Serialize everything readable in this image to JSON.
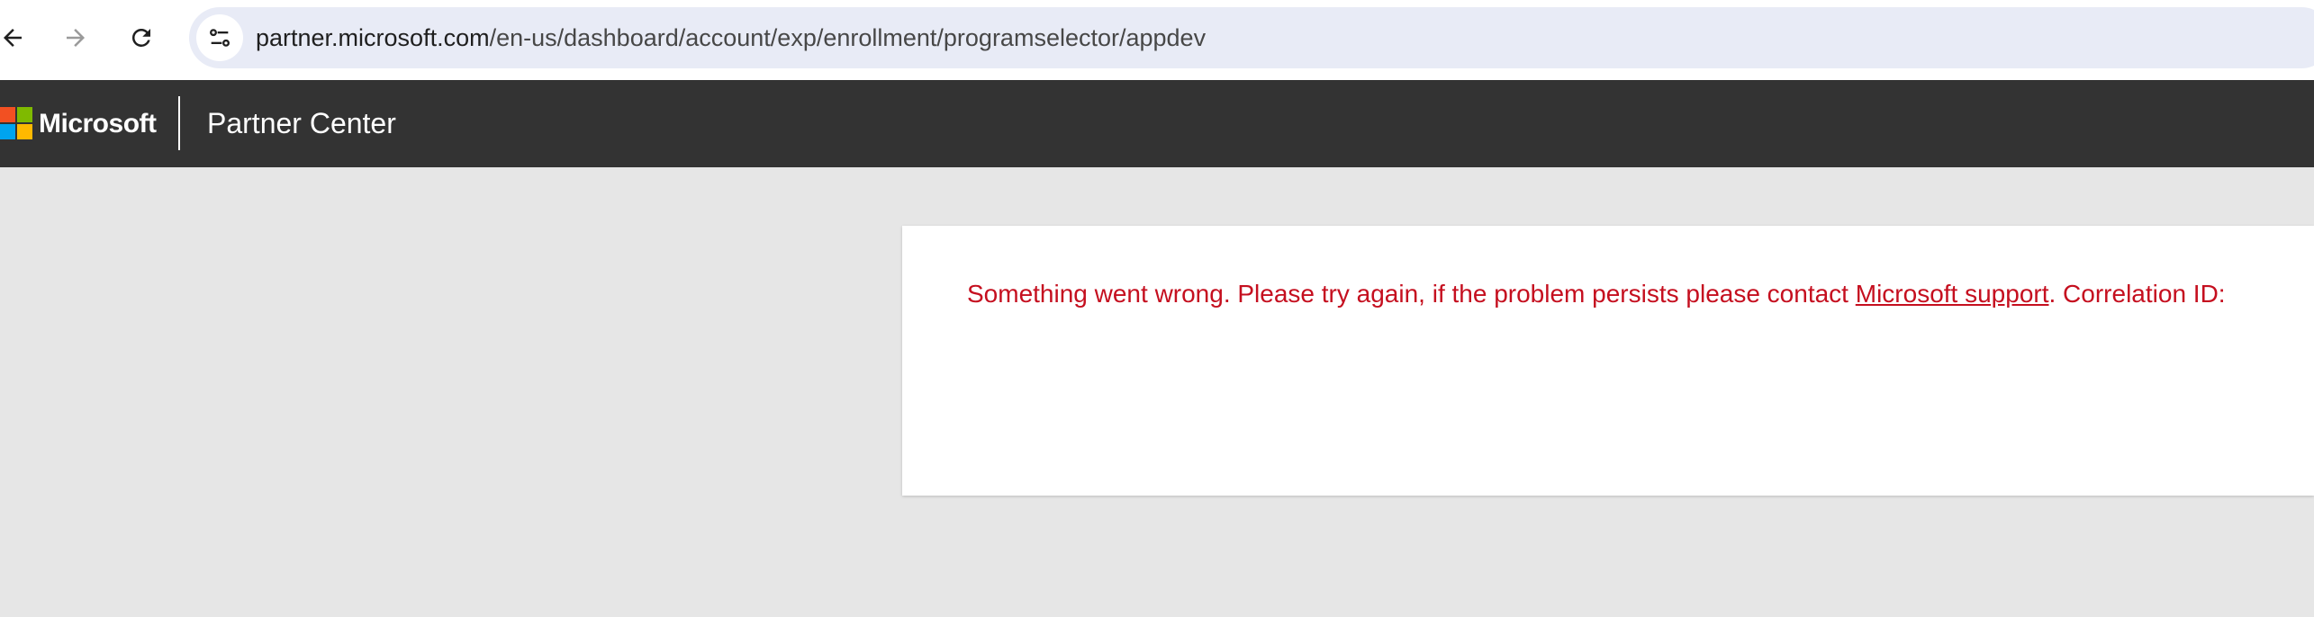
{
  "browser": {
    "url_domain": "partner.microsoft.com",
    "url_path": "/en-us/dashboard/account/exp/enrollment/programselector/appdev"
  },
  "header": {
    "brand": "Microsoft",
    "title": "Partner Center"
  },
  "content": {
    "error_prefix": "Something went wrong. Please try again, if the problem persists please contact ",
    "support_link": "Microsoft support",
    "error_suffix": ". Correlation ID:"
  },
  "colors": {
    "header_bg": "#333333",
    "page_bg": "#e6e6e6",
    "error_text": "#c50f1f",
    "omnibox_bg": "#e8ebf6"
  },
  "icons": {
    "back": "arrow-left-icon",
    "forward": "arrow-right-icon",
    "reload": "reload-icon",
    "site_info": "tune-icon",
    "logo": "microsoft-logo-icon"
  }
}
